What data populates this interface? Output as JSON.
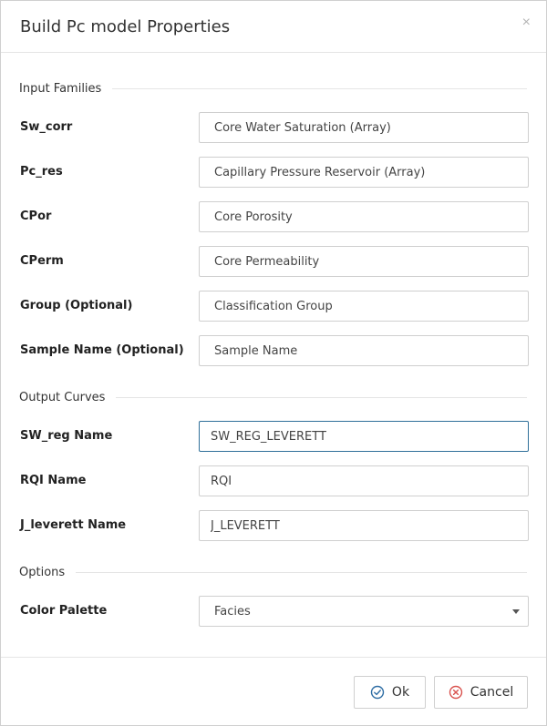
{
  "dialog": {
    "title": "Build Pc model Properties",
    "close_glyph": "×"
  },
  "sections": {
    "input_families": "Input Families",
    "output_curves": "Output Curves",
    "options": "Options"
  },
  "inputs": [
    {
      "label": "Sw_corr",
      "value": "Core Water Saturation (Array)"
    },
    {
      "label": "Pc_res",
      "value": "Capillary Pressure Reservoir (Array)"
    },
    {
      "label": "CPor",
      "value": "Core Porosity"
    },
    {
      "label": "CPerm",
      "value": "Core Permeability"
    },
    {
      "label": "Group (Optional)",
      "value": "Classification Group"
    },
    {
      "label": "Sample Name (Optional)",
      "value": "Sample Name"
    }
  ],
  "outputs": [
    {
      "label": "SW_reg Name",
      "value": "SW_REG_LEVERETT"
    },
    {
      "label": "RQI Name",
      "value": "RQI"
    },
    {
      "label": "J_leverett Name",
      "value": "J_LEVERETT"
    }
  ],
  "options": {
    "color_palette_label": "Color Palette",
    "color_palette_value": "Facies"
  },
  "buttons": {
    "ok_label": "Ok",
    "cancel_label": "Cancel"
  },
  "icons": {
    "ok": "check-circle-icon",
    "cancel": "x-circle-icon",
    "close": "close-icon"
  },
  "colors": {
    "ok_icon": "#2e6da4",
    "cancel_icon": "#d9534f",
    "focus_border": "#2f6f99"
  }
}
